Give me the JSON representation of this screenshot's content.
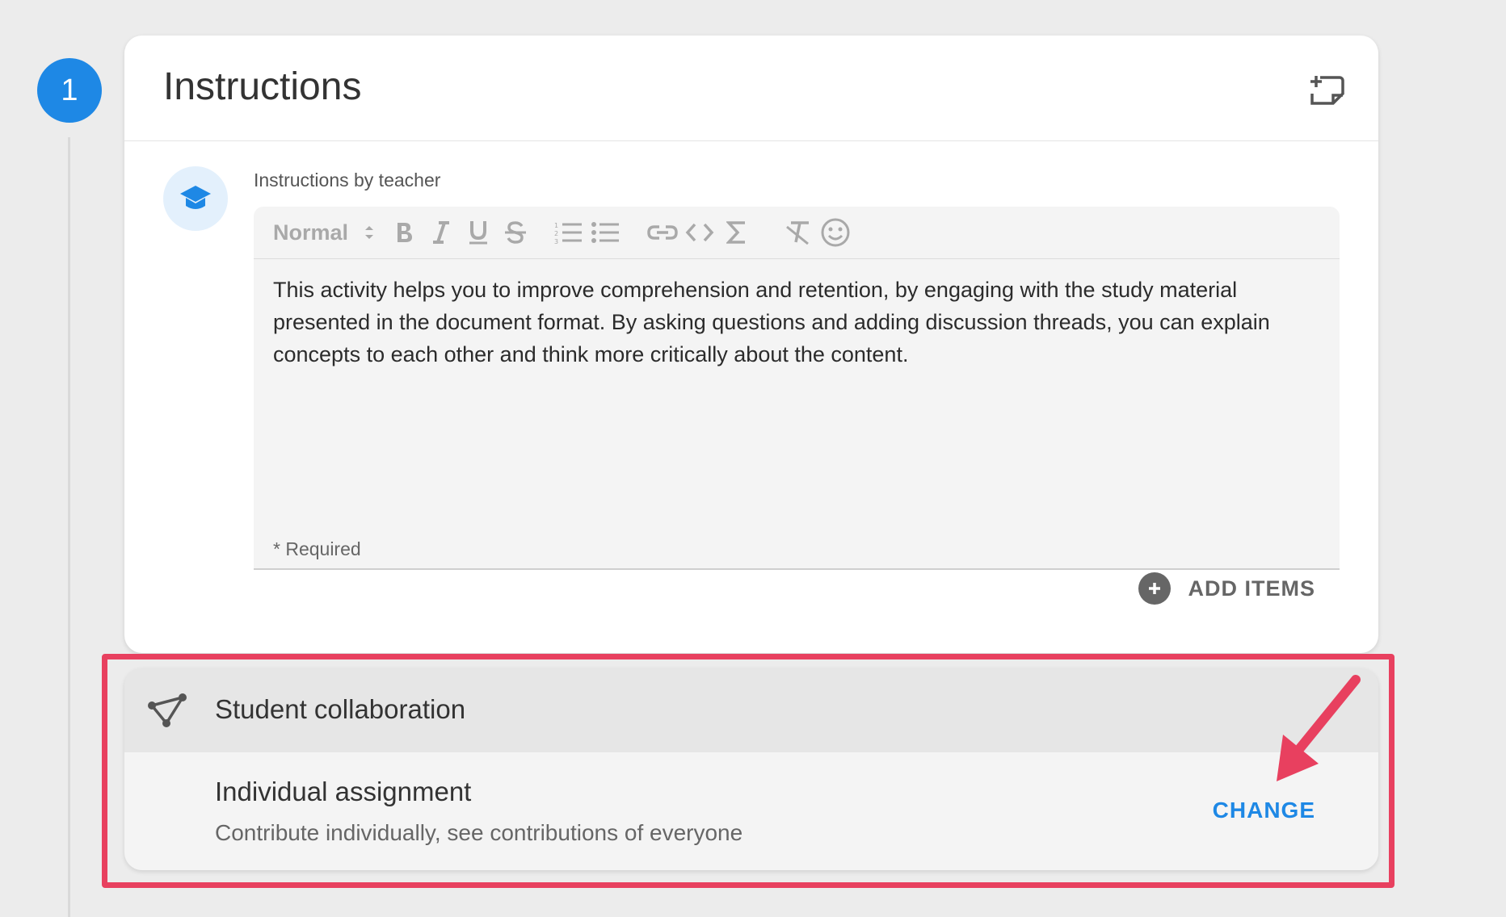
{
  "step": {
    "number": "1"
  },
  "instructions": {
    "title": "Instructions",
    "label": "Instructions by teacher",
    "toolbar": {
      "format": "Normal"
    },
    "body": "This activity helps you to improve comprehension and retention, by engaging with the study material presented in the document format. By asking questions and adding discussion threads, you can explain concepts to each other and think more critically about the content.",
    "required": "* Required",
    "add_items": "ADD ITEMS"
  },
  "collaboration": {
    "title": "Student collaboration",
    "assignment_title": "Individual assignment",
    "assignment_desc": "Contribute individually, see contributions of everyone",
    "change": "CHANGE"
  },
  "colors": {
    "accent": "#1e88e5",
    "highlight": "#e8405f"
  },
  "icons": [
    "note-add-icon",
    "teacher-icon",
    "bold-icon",
    "italic-icon",
    "underline-icon",
    "strikethrough-icon",
    "ordered-list-icon",
    "bullet-list-icon",
    "link-icon",
    "code-icon",
    "formula-icon",
    "clear-format-icon",
    "emoji-icon",
    "plus-circle-icon",
    "collaboration-icon",
    "arrow-annotation"
  ]
}
